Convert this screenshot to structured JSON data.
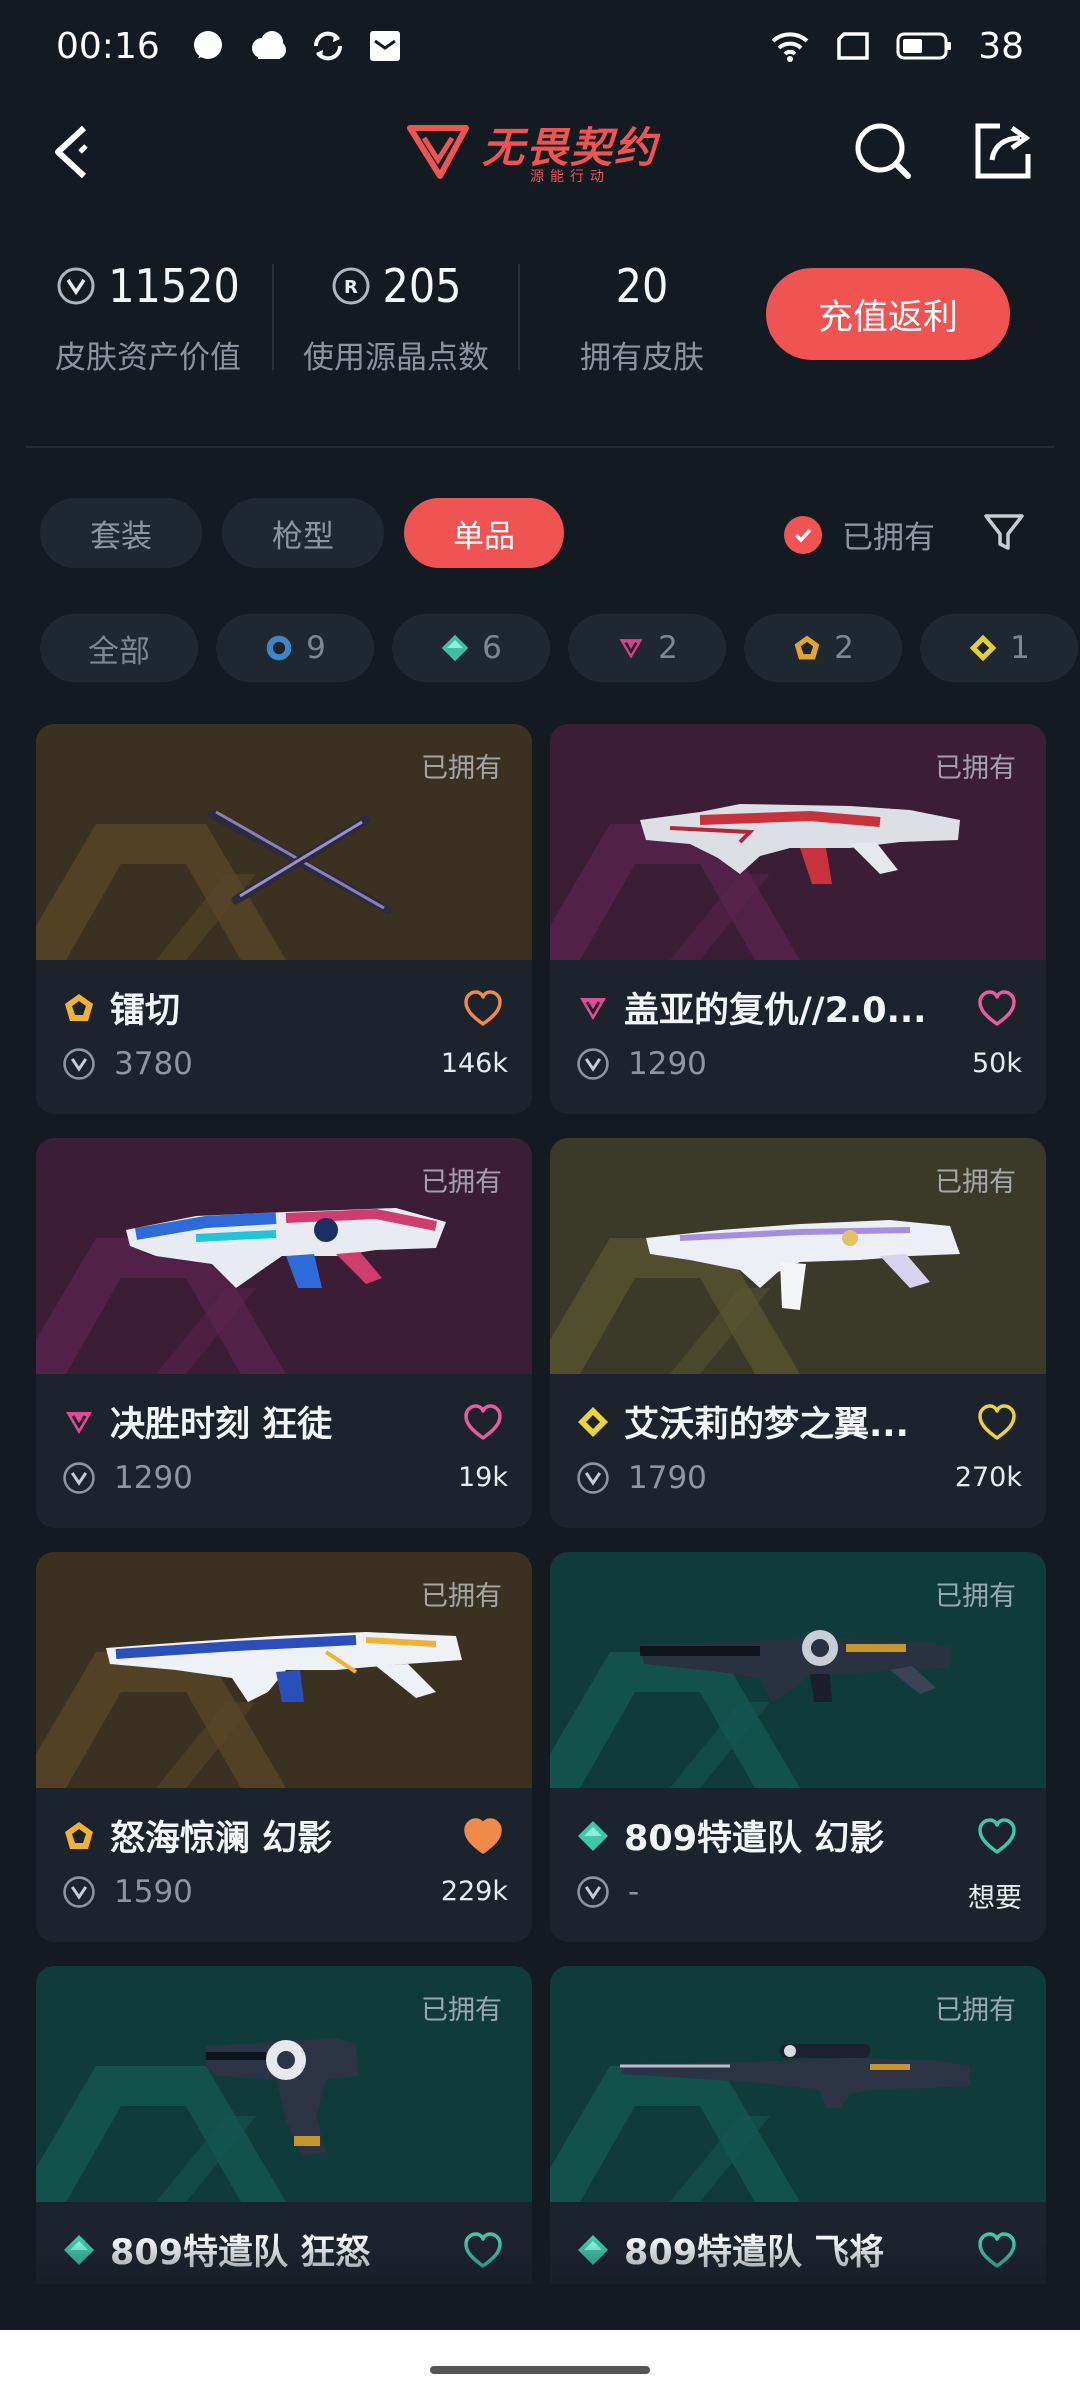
{
  "status_bar": {
    "time": "00:16",
    "battery": "38"
  },
  "header": {
    "logo_text": "无畏契约",
    "logo_sub": "源能行动"
  },
  "stats": [
    {
      "value": "11520",
      "label": "皮肤资产价值",
      "icon": "vp-coin-icon"
    },
    {
      "value": "205",
      "label": "使用源晶点数",
      "icon": "radianite-icon"
    },
    {
      "value": "20",
      "label": "拥有皮肤",
      "icon": ""
    }
  ],
  "recharge_label": "充值返利",
  "tabs": [
    "套装",
    "枪型",
    "单品"
  ],
  "active_tab": "单品",
  "owned_filter_label": "已拥有",
  "rarity_chips": [
    {
      "label": "全部",
      "count": "",
      "color": ""
    },
    {
      "label": "",
      "count": "9",
      "color": "#3f86c7",
      "icon": "select-tier-icon"
    },
    {
      "label": "",
      "count": "6",
      "color": "#3fbfa2",
      "icon": "deluxe-tier-icon"
    },
    {
      "label": "",
      "count": "2",
      "color": "#d9418e",
      "icon": "premium-tier-icon"
    },
    {
      "label": "",
      "count": "2",
      "color": "#e2a52f",
      "icon": "exclusive-tier-icon"
    },
    {
      "label": "",
      "count": "1",
      "color": "#e2cf3a",
      "icon": "ultra-tier-icon"
    }
  ],
  "cards": [
    {
      "owned": "已拥有",
      "name": "镭切",
      "price": "3780",
      "count": "146k",
      "tier": "exclusive",
      "tier_color": "#f0b232",
      "theme": "gold",
      "heart_color": "#f08a4b",
      "heart_filled": false,
      "weapon": "knife"
    },
    {
      "owned": "已拥有",
      "name": "盖亚的复仇//2.0...",
      "price": "1290",
      "count": "50k",
      "tier": "premium",
      "tier_color": "#e44a93",
      "theme": "magenta",
      "heart_color": "#ea5aa0",
      "heart_filled": false,
      "weapon": "rifle-red"
    },
    {
      "owned": "已拥有",
      "name": "决胜时刻 狂徒",
      "price": "1290",
      "count": "19k",
      "tier": "premium",
      "tier_color": "#e44a93",
      "theme": "magenta",
      "heart_color": "#ea5aa0",
      "heart_filled": false,
      "weapon": "rifle-blue"
    },
    {
      "owned": "已拥有",
      "name": "艾沃莉的梦之翼...",
      "price": "1790",
      "count": "270k",
      "tier": "ultra",
      "tier_color": "#e9d53b",
      "theme": "olive",
      "heart_color": "#e9d53b",
      "heart_filled": false,
      "weapon": "rifle-white"
    },
    {
      "owned": "已拥有",
      "name": "怒海惊澜 幻影",
      "price": "1590",
      "count": "229k",
      "tier": "exclusive",
      "tier_color": "#f0b232",
      "theme": "gold",
      "heart_color": "#f08a4b",
      "heart_filled": true,
      "weapon": "rifle-wave"
    },
    {
      "owned": "已拥有",
      "name": "809特遣队 幻影",
      "price": "-",
      "count": "想要",
      "tier": "deluxe",
      "tier_color": "#3fc7a8",
      "theme": "teal",
      "heart_color": "#3fc7a8",
      "heart_filled": false,
      "weapon": "rifle-dark"
    },
    {
      "owned": "已拥有",
      "name": "809特遣队 狂怒",
      "price": "",
      "count": "",
      "tier": "deluxe",
      "tier_color": "#3fc7a8",
      "theme": "teal",
      "heart_color": "#3fc7a8",
      "heart_filled": false,
      "weapon": "pistol"
    },
    {
      "owned": "已拥有",
      "name": "809特遣队 飞将",
      "price": "",
      "count": "",
      "tier": "deluxe",
      "tier_color": "#3fc7a8",
      "theme": "teal",
      "heart_color": "#3fc7a8",
      "heart_filled": false,
      "weapon": "sniper"
    }
  ]
}
